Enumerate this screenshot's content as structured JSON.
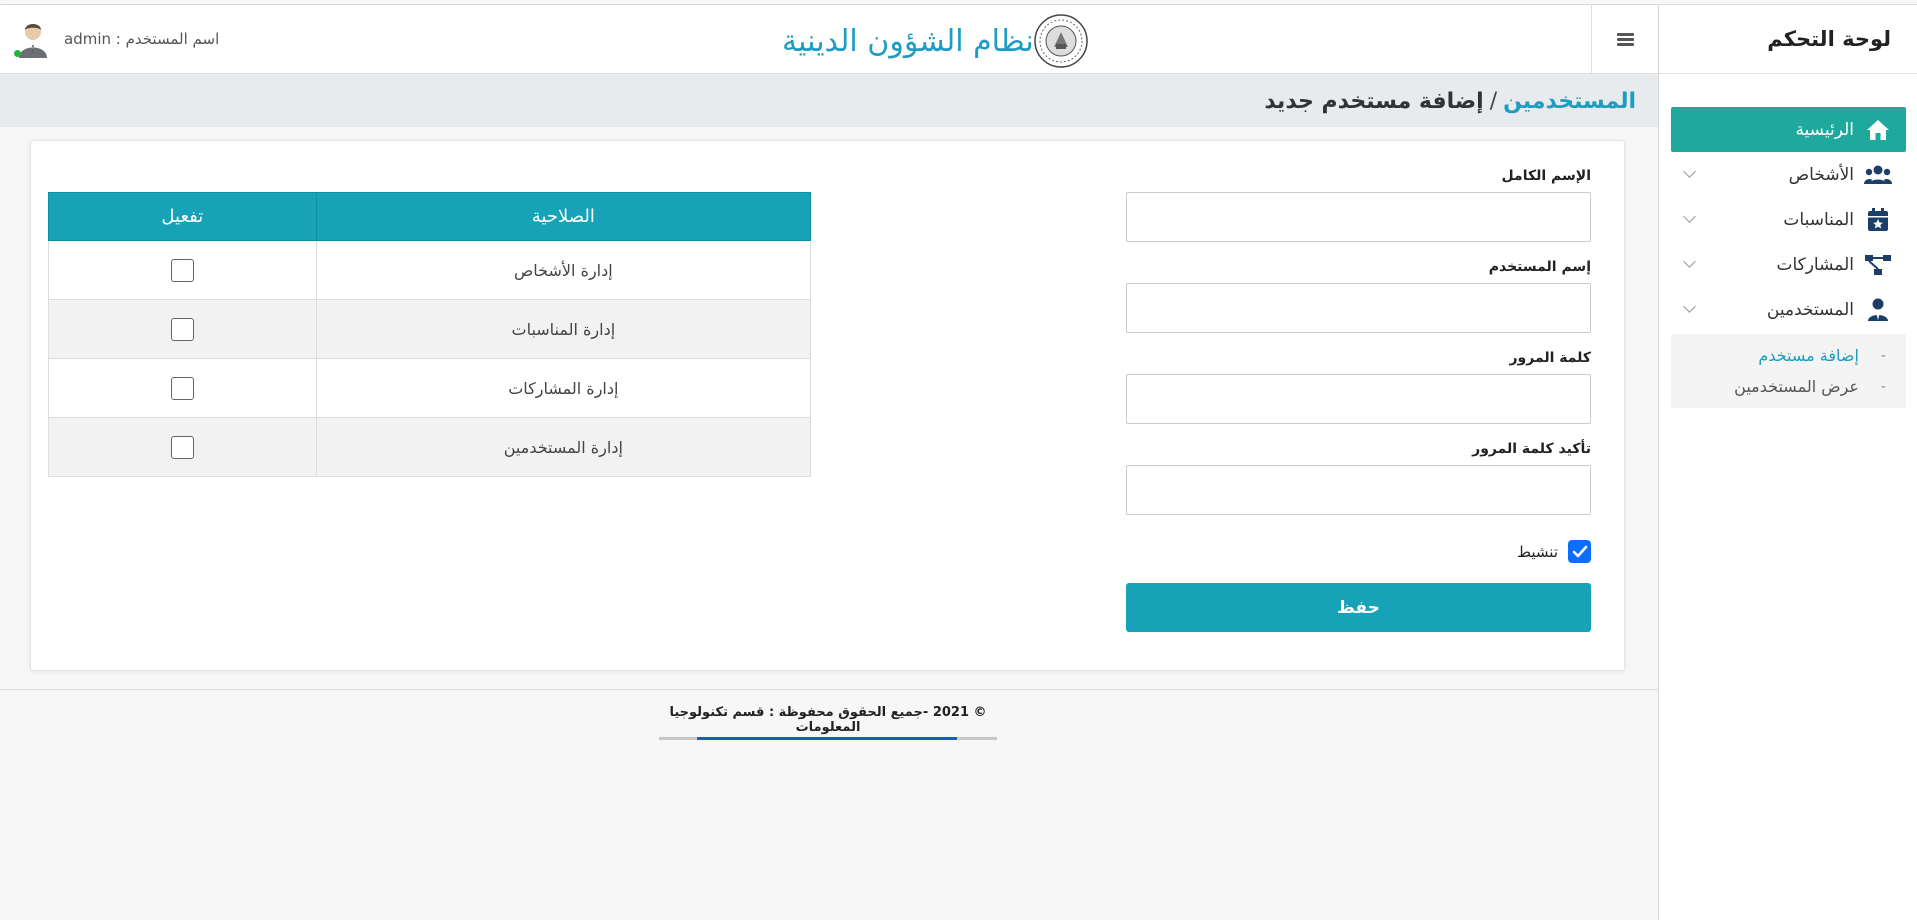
{
  "sidebar": {
    "title": "لوحة التحكم",
    "items": [
      {
        "label": "الرئيسية",
        "icon": "home-icon",
        "active": true
      },
      {
        "label": "الأشخاص",
        "icon": "users-icon"
      },
      {
        "label": "المناسبات",
        "icon": "calendar-star-icon"
      },
      {
        "label": "المشاركات",
        "icon": "sitemap-icon"
      },
      {
        "label": "المستخدمين",
        "icon": "user-tie-icon"
      }
    ],
    "submenu": [
      {
        "label": "إضافة مستخدم",
        "active": true
      },
      {
        "label": "عرض المستخدمين"
      }
    ]
  },
  "header": {
    "app_title": "نظام الشؤون الدينية",
    "user_label": "اسم المستخدم : admin"
  },
  "breadcrumb": {
    "parent": "المستخدمين",
    "separator": "/",
    "current": "إضافة مستخدم جديد"
  },
  "form": {
    "full_name_label": "الإسم الكامل",
    "full_name_value": "",
    "username_label": "إسم المستخدم",
    "username_value": "",
    "password_label": "كلمة المرور",
    "password_value": "",
    "confirm_password_label": "تأكيد كلمة المرور",
    "confirm_password_value": "",
    "activate_label": "تنشيط",
    "activate_checked": true,
    "save_label": "حفظ"
  },
  "permissions": {
    "headers": {
      "permission": "الصلاحية",
      "enable": "تفعيل"
    },
    "rows": [
      {
        "name": "إدارة الأشخاص",
        "checked": false
      },
      {
        "name": "إدارة المناسبات",
        "checked": false
      },
      {
        "name": "إدارة المشاركات",
        "checked": false
      },
      {
        "name": "إدارة المستخدمين",
        "checked": false
      }
    ]
  },
  "footer": {
    "text": "© 2021 -جميع الحقوق محفوظة : قسم تكنولوجيا المعلومات"
  },
  "colors": {
    "accent": "#17a2b8",
    "sidebar_active": "#1fa99c",
    "title_blue": "#1e9dc0",
    "checkbox_blue": "#0d6efd"
  }
}
